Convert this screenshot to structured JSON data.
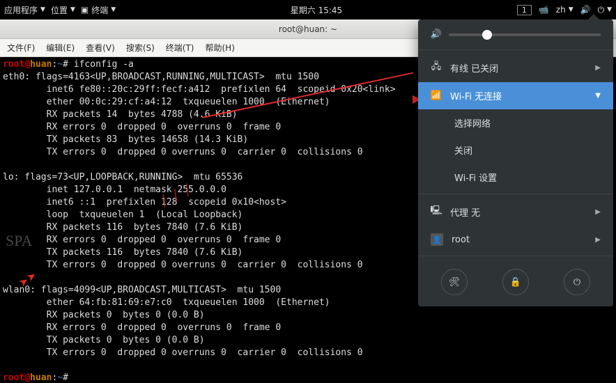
{
  "topbar": {
    "apps": "应用程序",
    "places": "位置",
    "term_icon": "▣",
    "term": "终端",
    "clock": "星期六 15:45",
    "lang": "zh",
    "workspace": "1"
  },
  "window": {
    "title": "root@huan: ~"
  },
  "menubar": {
    "file": "文件(F)",
    "edit": "编辑(E)",
    "view": "查看(V)",
    "search": "搜索(S)",
    "terminal": "终端(T)",
    "help": "帮助(H)"
  },
  "prompt": {
    "user": "root",
    "host": "huan",
    "sep1": "@",
    "sep2": ":",
    "path": "~",
    "hash": "#"
  },
  "command": " ifconfig -a",
  "output": "eth0: flags=4163<UP,BROADCAST,RUNNING,MULTICAST>  mtu 1500\n        inet6 fe80::20c:29ff:fecf:a412  prefixlen 64  scopeid 0x20<link>\n        ether 00:0c:29:cf:a4:12  txqueuelen 1000  (Ethernet)\n        RX packets 14  bytes 4788 (4.6 KiB)\n        RX errors 0  dropped 0  overruns 0  frame 0\n        TX packets 83  bytes 14658 (14.3 KiB)\n        TX errors 0  dropped 0 overruns 0  carrier 0  collisions 0\n\nlo: flags=73<UP,LOOPBACK,RUNNING>  mtu 65536\n        inet 127.0.0.1  netmask 255.0.0.0\n        inet6 ::1  prefixlen 128  scopeid 0x10<host>\n        loop  txqueuelen 1  (Local Loopback)\n        RX packets 116  bytes 7840 (7.6 KiB)\n        RX errors 0  dropped 0  overruns 0  frame 0\n        TX packets 116  bytes 7840 (7.6 KiB)\n        TX errors 0  dropped 0 overruns 0  carrier 0  collisions 0\n\nwlan0: flags=4099<UP,BROADCAST,MULTICAST>  mtu 1500\n        ether 64:fb:81:69:e7:c0  txqueuelen 1000  (Ethernet)\n        RX packets 0  bytes 0 (0.0 B)\n        RX errors 0  dropped 0  overruns 0  frame 0\n        TX packets 0  bytes 0 (0.0 B)\n        TX errors 0  dropped 0 overruns 0  carrier 0  collisions 0\n",
  "popover": {
    "volume_pct": 22,
    "wired": "有线 已关闭",
    "wifi": "Wi-Fi 无连接",
    "select_net": "选择网络",
    "off": "关闭",
    "wifi_settings": "Wi-Fi 设置",
    "proxy": "代理 无",
    "user": "root"
  },
  "watermark": "SPA"
}
